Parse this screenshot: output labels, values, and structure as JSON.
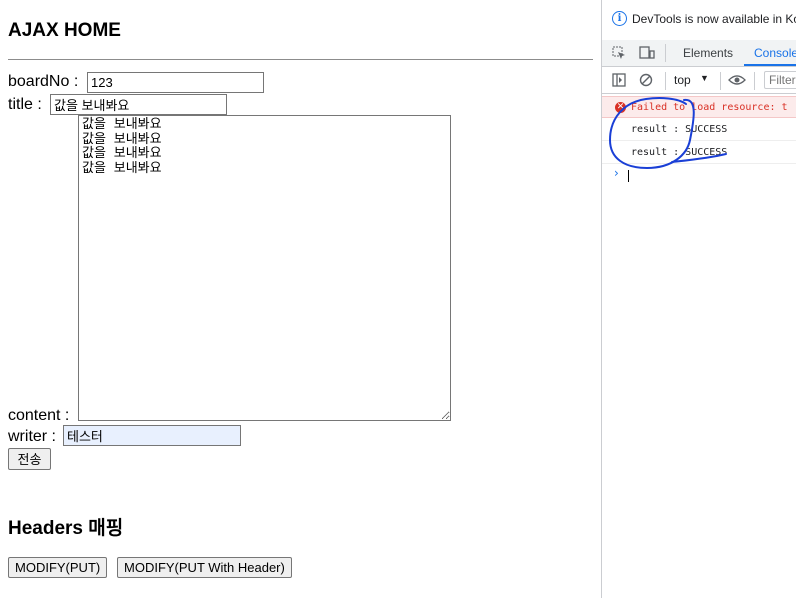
{
  "page": {
    "title": "AJAX HOME",
    "form": {
      "boardNo_label": "boardNo : ",
      "boardNo_value": "123",
      "title_label": "title : ",
      "title_value": "값을 보내봐요",
      "content_label": "content : ",
      "content_value": "값을 보내봐요\n값을 보내봐요\n값을 보내봐요\n값을 보내봐요",
      "writer_label": "writer : ",
      "writer_value": "테스터",
      "submit_label": "전송"
    },
    "headers_title": "Headers 매핑",
    "buttons": {
      "modify_put": "MODIFY(PUT)",
      "modify_put_header": "MODIFY(PUT With Header)"
    }
  },
  "devtools": {
    "info_text": "DevTools is now available in Ko",
    "tabs": [
      "Elements",
      "Console"
    ],
    "active_tab": "Console",
    "context": "top",
    "filter_placeholder": "Filter",
    "console": {
      "error": "Failed to load resource: t",
      "logs": [
        "result : SUCCESS",
        "result : SUCCESS"
      ]
    },
    "annotation_color": "#1a3fd6",
    "accent": "#1a73e8",
    "error_color": "#d93025"
  }
}
